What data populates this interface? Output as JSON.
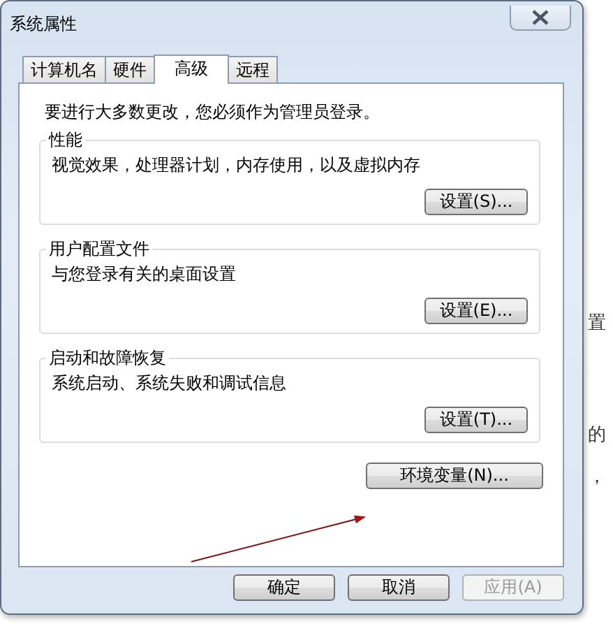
{
  "window": {
    "title": "系统属性"
  },
  "tabs": [
    {
      "label": "计算机名",
      "selected": false
    },
    {
      "label": "硬件",
      "selected": false
    },
    {
      "label": "高级",
      "selected": true
    },
    {
      "label": "远程",
      "selected": false
    }
  ],
  "notice": "要进行大多数更改，您必须作为管理员登录。",
  "groups": [
    {
      "title": "性能",
      "description": "视觉效果，处理器计划，内存使用，以及虚拟内存",
      "button": "设置(S)..."
    },
    {
      "title": "用户配置文件",
      "description": "与您登录有关的桌面设置",
      "button": "设置(E)..."
    },
    {
      "title": "启动和故障恢复",
      "description": "系统启动、系统失败和调试信息",
      "button": "设置(T)..."
    }
  ],
  "env_button": "环境变量(N)...",
  "buttons": [
    {
      "label": "确定",
      "disabled": false
    },
    {
      "label": "取消",
      "disabled": false
    },
    {
      "label": "应用(A)",
      "disabled": true
    }
  ],
  "background_fragments": [
    "置",
    "的",
    "，"
  ]
}
